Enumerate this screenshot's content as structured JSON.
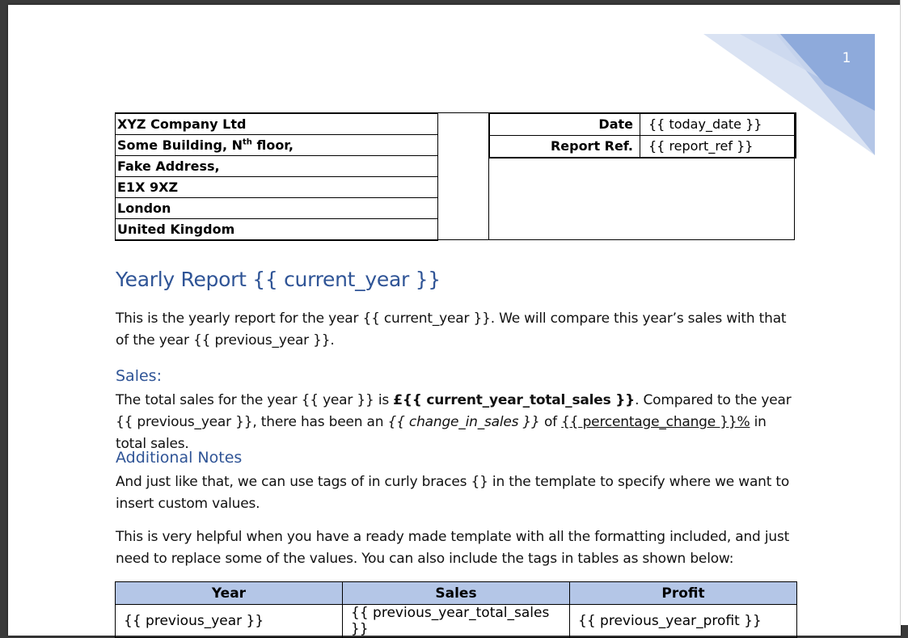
{
  "page_number": "1",
  "address": [
    "XYZ Company Ltd",
    "Some Building, N",
    "Fake Address,",
    "E1X 9XZ",
    "London",
    "United Kingdom"
  ],
  "address_sup": "th",
  "address_line2_tail": " floor,",
  "info": {
    "date_label": "Date",
    "date_value": "{{ today_date }}",
    "ref_label": "Report Ref.",
    "ref_value": "{{ report_ref }}"
  },
  "title": "Yearly Report {{ current_year }}",
  "intro": "This is the yearly report for the year {{ current_year }}. We will compare this year’s sales with that of the year {{ previous_year }}.",
  "sales": {
    "heading": "Sales:",
    "t1": "The total sales for the year {{ year }} is ",
    "bold": "£{{ current_year_total_sales }}",
    "t2": ". Compared to the year {{ previous_year }}, there has been an ",
    "italic": "{{ change_in_sales }}",
    "t3": " of ",
    "underline": "{{ percentage_change }}%",
    "t4": " in total sales."
  },
  "notes": {
    "heading": "Additional Notes",
    "p1": "And just like that, we can use tags of in curly braces {} in the template to specify where we want to insert custom values.",
    "p2": "This is very helpful when you have a ready made template with all the formatting included, and just need to replace some of the values. You can also include the tags in tables as shown below:"
  },
  "table": {
    "headers": [
      "Year",
      "Sales",
      "Profit"
    ],
    "row": [
      "{{ previous_year }}",
      "{{ previous_year_total_sales }}",
      "{{ previous_year_profit }}"
    ]
  },
  "colors": {
    "heading": "#2f5496",
    "table_header": "#b4c6e7",
    "corner": "#8eaadb"
  }
}
